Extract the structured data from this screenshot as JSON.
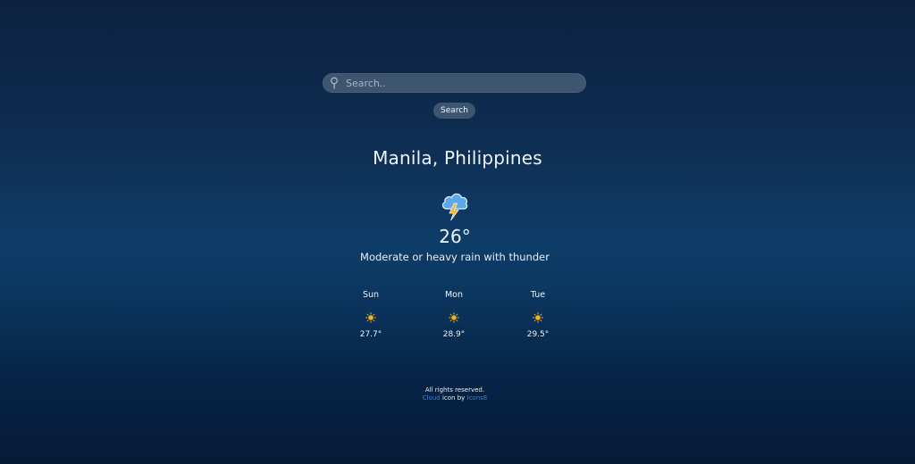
{
  "search": {
    "placeholder": "Search..",
    "value": "",
    "button_label": "Search"
  },
  "current": {
    "location": "Manila, Philippines",
    "temperature": "26°",
    "condition": "Moderate or heavy rain with thunder",
    "icon": "thunderstorm-cloud-icon"
  },
  "forecast": [
    {
      "day": "Sun",
      "temp": "27.7°",
      "icon": "sun-icon"
    },
    {
      "day": "Mon",
      "temp": "28.9°",
      "icon": "sun-icon"
    },
    {
      "day": "Tue",
      "temp": "29.5°",
      "icon": "sun-icon"
    }
  ],
  "footer": {
    "rights": "All rights reserved.",
    "credit_link": "Cloud",
    "credit_mid": " icon by ",
    "author_link": "Icons8"
  },
  "colors": {
    "link": "#3b7fd9",
    "input_bg": "#3e5570",
    "sun": "#f3b21c",
    "cloud": "#5da8e8",
    "bolt": "#f6b830"
  }
}
